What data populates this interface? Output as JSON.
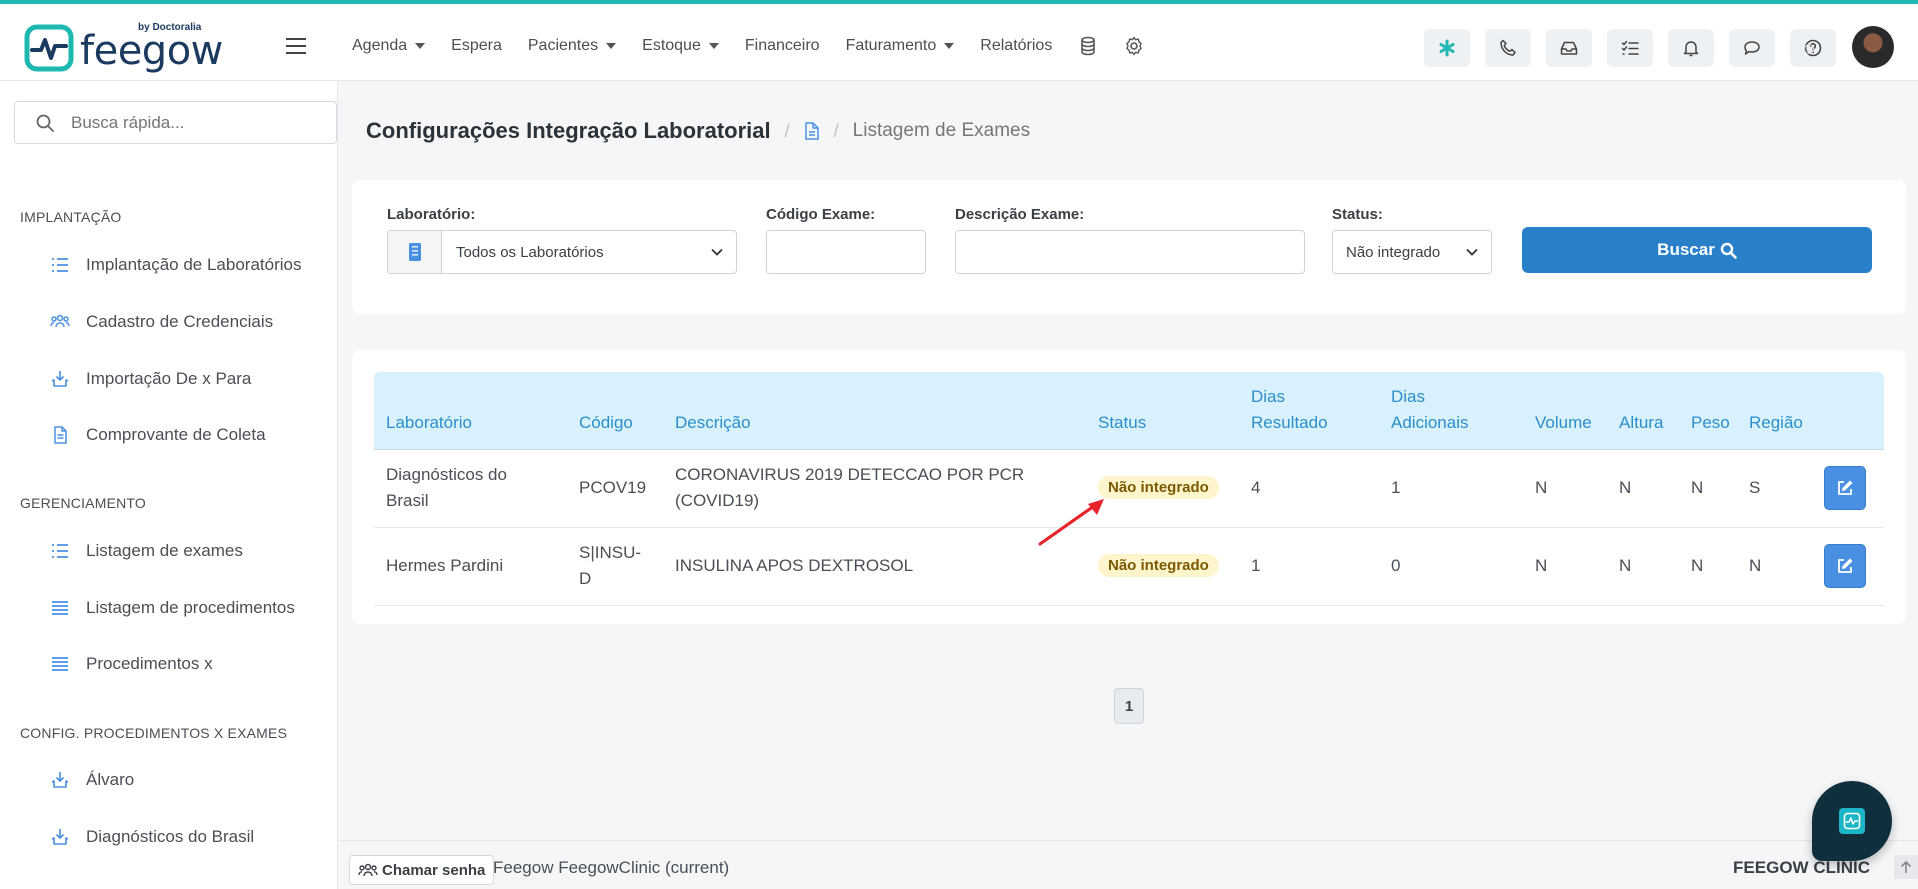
{
  "brand": {
    "name": "feegow",
    "by": "by Doctoralia",
    "accent": "#1fb8b0"
  },
  "nav": {
    "items": [
      {
        "label": "Agenda",
        "dropdown": true
      },
      {
        "label": "Espera",
        "dropdown": false
      },
      {
        "label": "Pacientes",
        "dropdown": true
      },
      {
        "label": "Estoque",
        "dropdown": true
      },
      {
        "label": "Financeiro",
        "dropdown": false
      },
      {
        "label": "Faturamento",
        "dropdown": true
      },
      {
        "label": "Relatórios",
        "dropdown": false
      }
    ],
    "icons": [
      "database-icon",
      "gear-icon"
    ]
  },
  "toolbar": {
    "icons": [
      "asterisk-icon",
      "phone-icon",
      "inbox-icon",
      "checklist-icon",
      "bell-icon",
      "chat-icon",
      "help-icon"
    ]
  },
  "sidebar": {
    "search_placeholder": "Busca rápida...",
    "sections": [
      {
        "title": "IMPLANTAÇÃO",
        "items": [
          {
            "label": "Implantação de Laboratórios",
            "icon": "list-icon"
          },
          {
            "label": "Cadastro de Credenciais",
            "icon": "users-icon"
          },
          {
            "label": "Importação De x Para",
            "icon": "download-icon"
          },
          {
            "label": "Comprovante de Coleta",
            "icon": "document-icon"
          }
        ]
      },
      {
        "title": "GERENCIAMENTO",
        "items": [
          {
            "label": "Listagem de exames",
            "icon": "list-icon"
          },
          {
            "label": "Listagem de procedimentos",
            "icon": "list-icon"
          },
          {
            "label": "Procedimentos x",
            "icon": "list-icon"
          }
        ]
      },
      {
        "title": "CONFIG. PROCEDIMENTOS X EXAMES",
        "items": [
          {
            "label": "Álvaro",
            "icon": "download-icon"
          },
          {
            "label": "Diagnósticos do Brasil",
            "icon": "download-icon"
          }
        ]
      }
    ]
  },
  "page": {
    "title": "Configurações Integração Laboratorial",
    "breadcrumb_current": "Listagem de Exames"
  },
  "filters": {
    "lab_label": "Laboratório:",
    "lab_value": "Todos os Laboratórios",
    "code_label": "Código Exame:",
    "code_value": "",
    "desc_label": "Descrição Exame:",
    "desc_value": "",
    "status_label": "Status:",
    "status_value": "Não integrado",
    "search_button": "Buscar"
  },
  "table": {
    "headers": {
      "laboratorio": "Laboratório",
      "codigo": "Código",
      "descricao": "Descrição",
      "status": "Status",
      "dias_resultado_1": "Dias",
      "dias_resultado_2": "Resultado",
      "dias_adicionais_1": "Dias",
      "dias_adicionais_2": "Adicionais",
      "volume": "Volume",
      "altura": "Altura",
      "peso": "Peso",
      "regiao": "Região"
    },
    "rows": [
      {
        "lab_1": "Diagnósticos do",
        "lab_2": "Brasil",
        "codigo_1": "PCOV19",
        "codigo_2": "",
        "desc_1": "CORONAVIRUS 2019 DETECCAO POR PCR",
        "desc_2": "(COVID19)",
        "status": "Não integrado",
        "dias_resultado": "4",
        "dias_adicionais": "1",
        "volume": "N",
        "altura": "N",
        "peso": "N",
        "regiao": "S"
      },
      {
        "lab_1": "Hermes Pardini",
        "lab_2": "",
        "codigo_1": "S|INSU-",
        "codigo_2": "D",
        "desc_1": "INSULINA APOS DEXTROSOL",
        "desc_2": "",
        "status": "Não integrado",
        "dias_resultado": "1",
        "dias_adicionais": "0",
        "volume": "N",
        "altura": "N",
        "peso": "N",
        "regiao": "N"
      }
    ]
  },
  "pagination": {
    "current": "1"
  },
  "footer": {
    "call_button": "Chamar senha",
    "context": "Feegow FeegowClinic (current)",
    "clinic": "FEEGOW CLINIC"
  }
}
